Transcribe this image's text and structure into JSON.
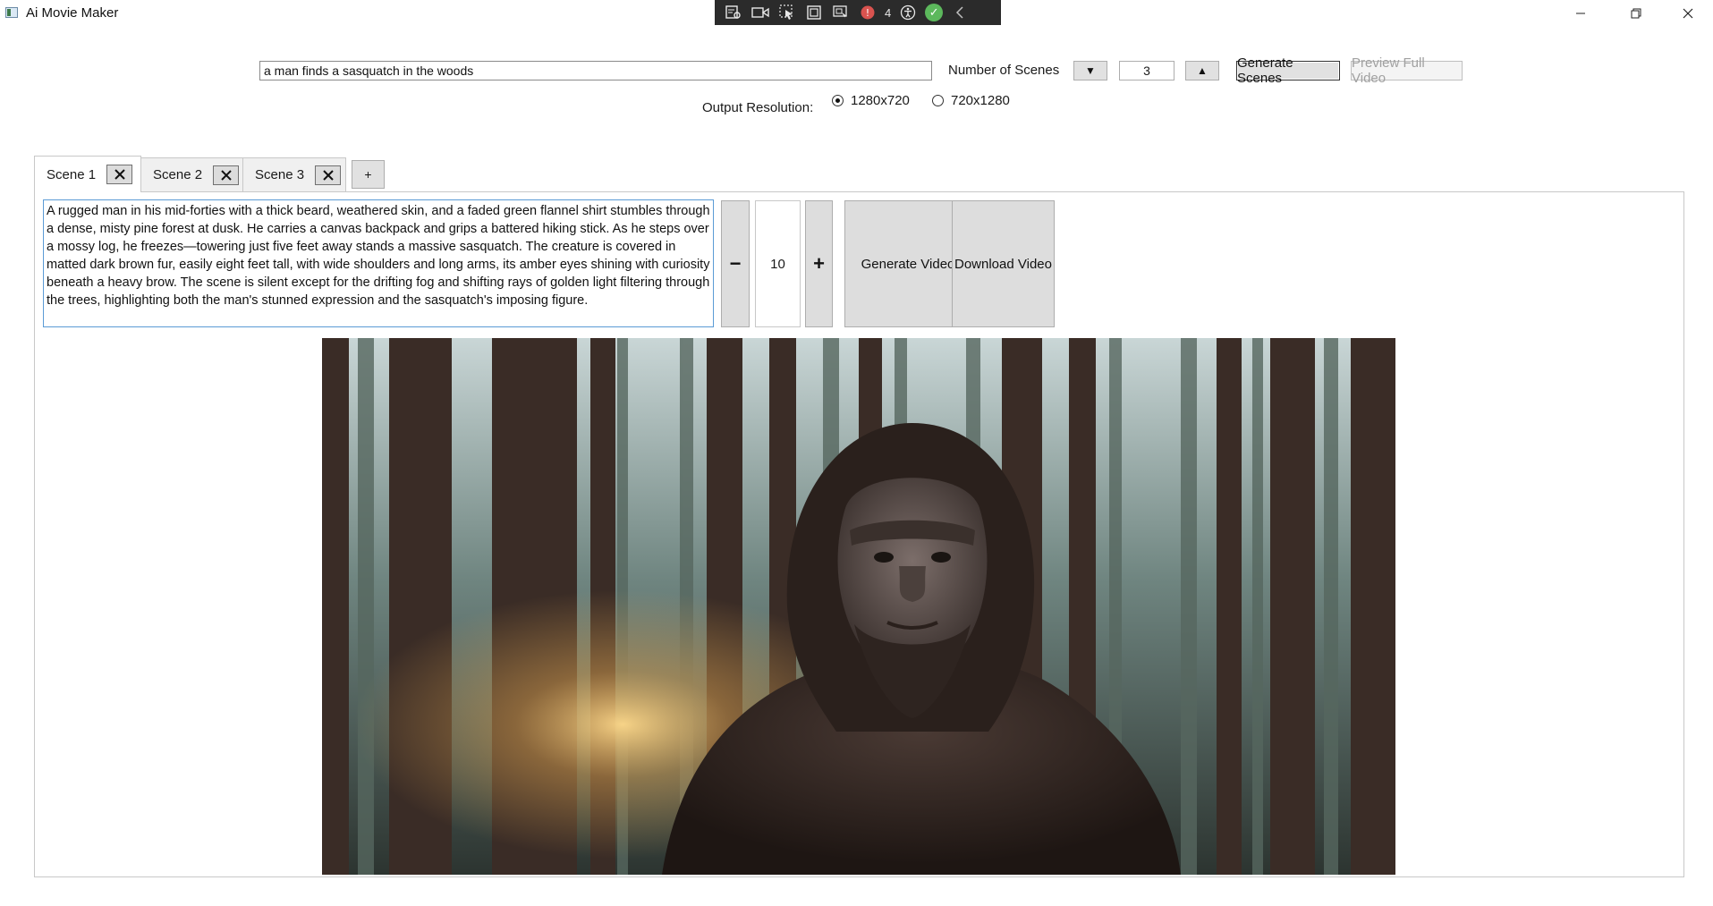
{
  "window": {
    "title": "Ai Movie Maker",
    "minimize_icon": "minimize-icon",
    "restore_icon": "restore-icon",
    "close_icon": "close-icon"
  },
  "debug_toolbar": {
    "icons": [
      "live-visual-tree-icon",
      "record-icon",
      "select-element-icon",
      "display-layout-adorners-icon",
      "track-focus-icon",
      "binding-failures-icon",
      "accessibility-icon",
      "checkmark-icon",
      "collapse-chevron-icon"
    ],
    "binding_failures_count": "4"
  },
  "prompt": {
    "value": "a man finds a sasquatch in the woods"
  },
  "scenes": {
    "label": "Number of Scenes",
    "decrement_symbol": "▼",
    "increment_symbol": "▲",
    "count": "3",
    "generate_label": "Generate Scenes",
    "preview_label": "Preview Full Video"
  },
  "resolution": {
    "label": "Output Resolution:",
    "options": [
      {
        "label": "1280x720",
        "selected": true
      },
      {
        "label": "720x1280",
        "selected": false
      }
    ]
  },
  "tabs": [
    {
      "label": "Scene 1",
      "active": true
    },
    {
      "label": "Scene 2",
      "active": false
    },
    {
      "label": "Scene 3",
      "active": false
    }
  ],
  "add_tab_label": "+",
  "scene": {
    "description": "A rugged man in his mid-forties with a thick beard, weathered skin, and a faded green flannel shirt stumbles through a dense, misty pine forest at dusk. He carries a canvas backpack and grips a battered hiking stick. As he steps over a mossy log, he freezes—towering just five feet away stands a massive sasquatch. The creature is covered in matted dark brown fur, easily eight feet tall, with wide shoulders and long arms, its amber eyes shining with curiosity beneath a heavy brow. The scene is silent except for the drifting fog and shifting rays of golden light filtering through the trees, highlighting both the man's stunned expression and the sasquatch's imposing figure.",
    "duration_decrement": "−",
    "duration_value": "10",
    "duration_increment": "+",
    "generate_video_label": "Generate Video",
    "download_video_label": "Download Video"
  },
  "colors": {
    "accent_border": "#5b9bd5",
    "debug_bar": "#2b2b2b",
    "ok_green": "#5cb85c"
  }
}
